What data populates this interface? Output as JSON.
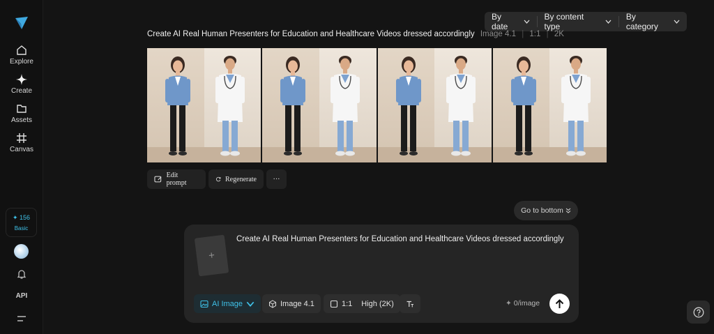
{
  "sidebar": {
    "items": [
      {
        "label": "Explore",
        "icon": "home-icon"
      },
      {
        "label": "Create",
        "icon": "sparkle-icon"
      },
      {
        "label": "Assets",
        "icon": "folder-icon"
      },
      {
        "label": "Canvas",
        "icon": "grid-hash-icon"
      }
    ],
    "credits": "✦ 156",
    "plan": "Basic",
    "api_label": "API"
  },
  "filters": {
    "date": "By date",
    "content_type": "By content type",
    "category": "By category"
  },
  "generation": {
    "prompt": "Create AI Real Human Presenters for Education and Healthcare Videos dressed accordingly",
    "model": "Image 4.1",
    "ratio": "1:1",
    "resolution": "2K",
    "image_count": 4
  },
  "actions": {
    "edit": "Edit prompt",
    "regenerate": "Regenerate",
    "more": "···"
  },
  "go_bottom": "Go to bottom",
  "composer": {
    "text": "Create AI Real Human Presenters for Education and Healthcare Videos dressed accordingly",
    "mode": "AI Image",
    "model": "Image 4.1",
    "ratio": "1:1",
    "quality": "High (2K)",
    "cost": "0/image"
  },
  "colors": {
    "accent": "#3fc1e8",
    "background": "#141414",
    "panel": "#252525"
  }
}
